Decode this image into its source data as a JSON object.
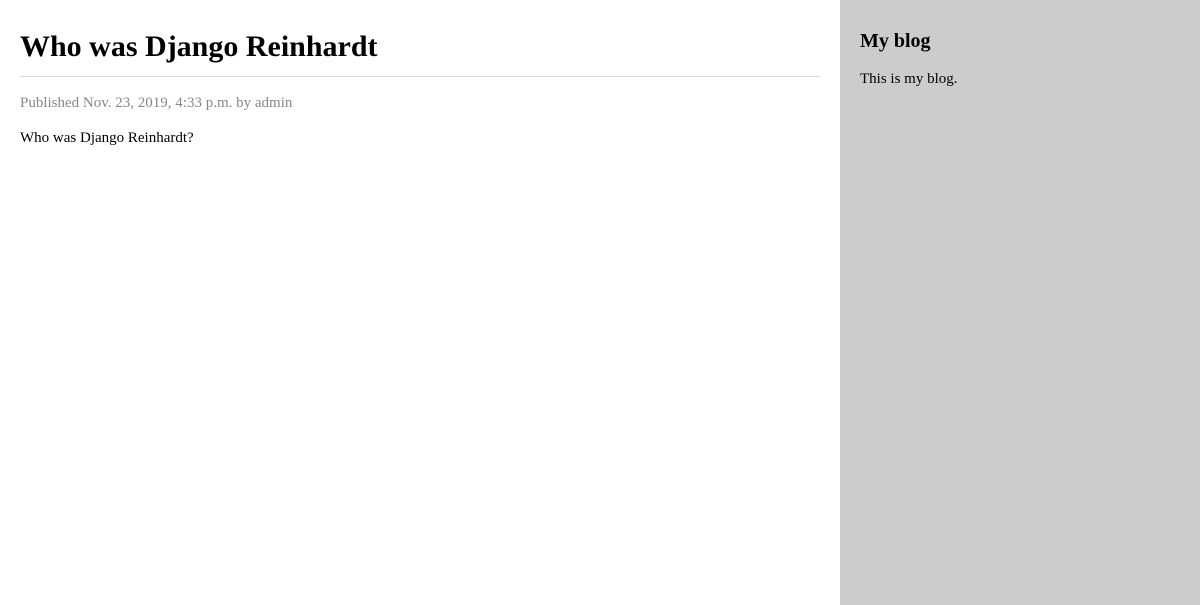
{
  "post": {
    "title": "Who was Django Reinhardt",
    "meta": "Published Nov. 23, 2019, 4:33 p.m. by admin",
    "body": "Who was Django Reinhardt?"
  },
  "sidebar": {
    "title": "My blog",
    "text": "This is my blog."
  }
}
